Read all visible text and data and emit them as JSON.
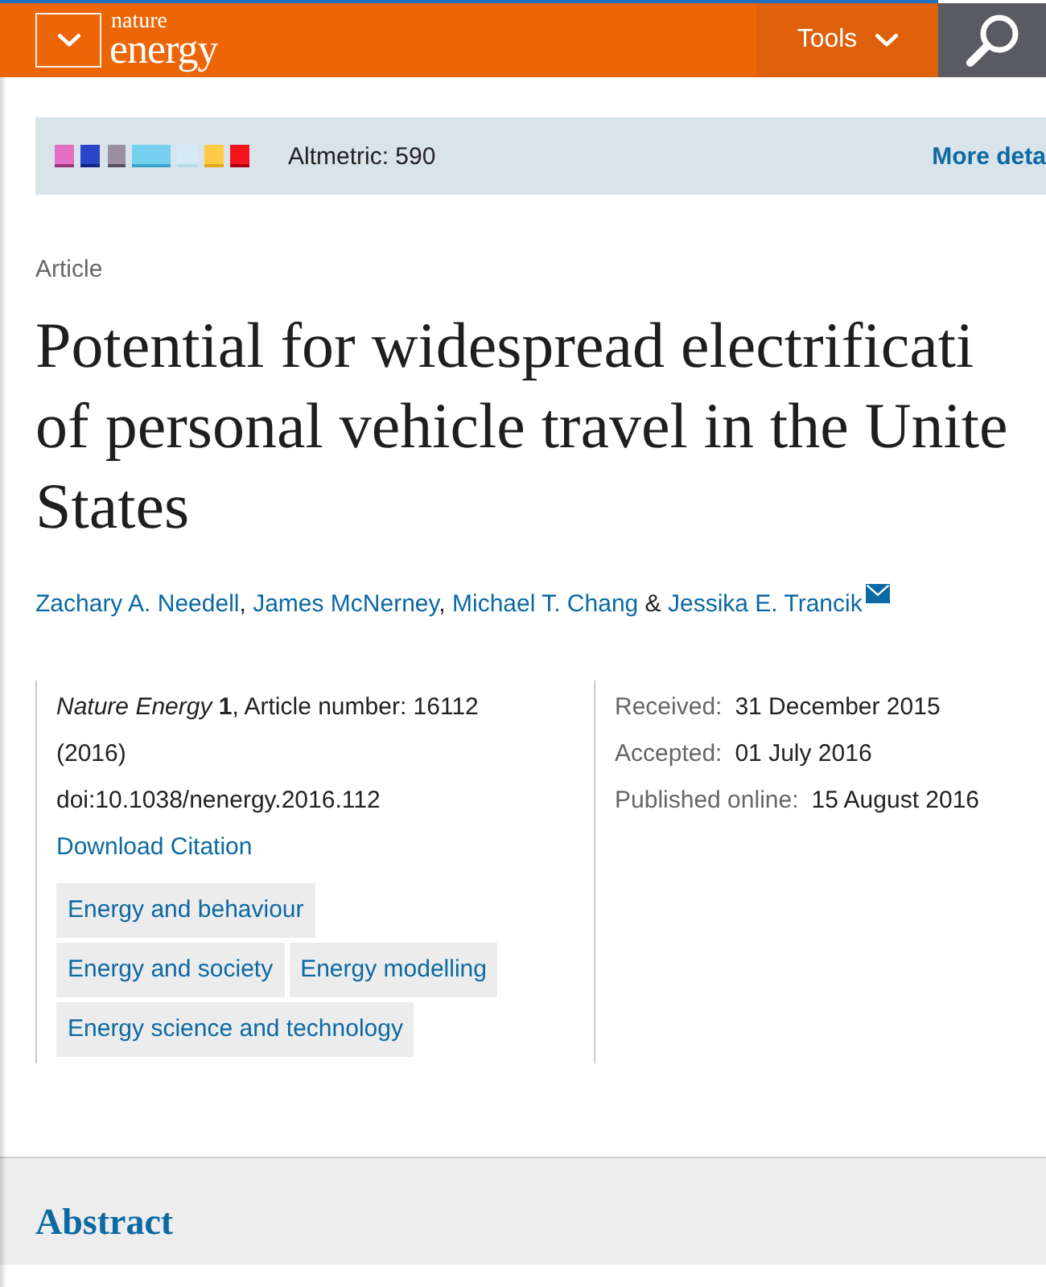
{
  "header": {
    "logo": {
      "small": "nature",
      "large": "energy"
    },
    "tools_label": "Tools"
  },
  "altmetric": {
    "score_label": "Altmetric: 590",
    "more_link": "More deta"
  },
  "article": {
    "type": "Article",
    "title_lines": [
      "Potential for widespread electrificati",
      "of personal vehicle travel in the Unite",
      "States"
    ],
    "authors": [
      {
        "name": "Zachary A. Needell",
        "joiner": ", ",
        "corresponding": false
      },
      {
        "name": "James McNerney",
        "joiner": ", ",
        "corresponding": false
      },
      {
        "name": "Michael T. Chang",
        "joiner": " & ",
        "corresponding": false
      },
      {
        "name": "Jessika E. Trancik",
        "corresponding": true
      }
    ]
  },
  "info": {
    "citation": "*Nature Energy* **1**, Article number: 16112 (2016)",
    "doi": "doi:10.1038/nenergy.2016.112",
    "download_link": "Download Citation",
    "subjects": [
      "Energy and behaviour",
      "Energy and society",
      "Energy modelling",
      "Energy science and technology"
    ],
    "dates": [
      {
        "label": "Received:",
        "value": "31 December 2015"
      },
      {
        "label": "Accepted:",
        "value": "01 July 2016"
      },
      {
        "label": "Published online:",
        "value": "15 August 2016"
      }
    ]
  },
  "abstract": {
    "heading": "Abstract"
  }
}
